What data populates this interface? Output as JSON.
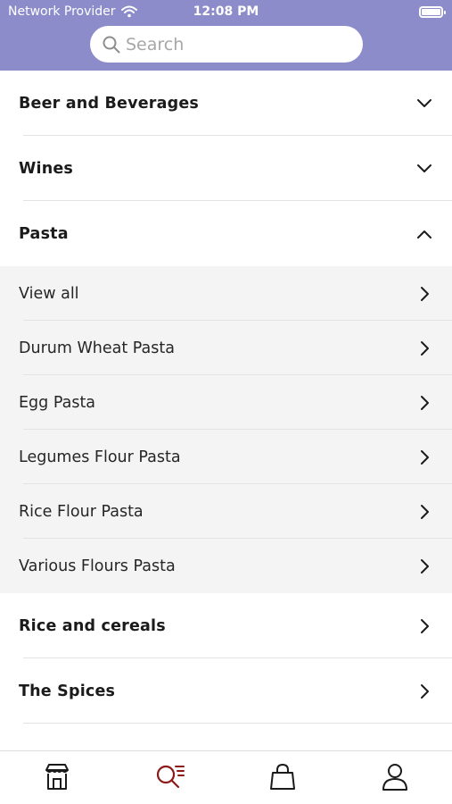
{
  "status_bar": {
    "carrier": "Network Provider",
    "time": "12:08 PM"
  },
  "search": {
    "placeholder": "Search"
  },
  "categories": [
    {
      "label": "Beer and Beverages",
      "state": "collapsed"
    },
    {
      "label": "Wines",
      "state": "collapsed"
    },
    {
      "label": "Pasta",
      "state": "expanded"
    }
  ],
  "pasta_subcategories": [
    {
      "label": "View all"
    },
    {
      "label": "Durum Wheat Pasta"
    },
    {
      "label": "Egg Pasta"
    },
    {
      "label": "Legumes Flour Pasta"
    },
    {
      "label": "Rice Flour Pasta"
    },
    {
      "label": "Various Flours Pasta"
    }
  ],
  "other_categories": [
    {
      "label": "Rice and cereals"
    },
    {
      "label": "The Spices"
    }
  ],
  "tab_bar": {
    "items": [
      {
        "icon": "store-icon",
        "active": false
      },
      {
        "icon": "search-list-icon",
        "active": true
      },
      {
        "icon": "shopping-bag-icon",
        "active": false
      },
      {
        "icon": "user-icon",
        "active": false
      }
    ]
  },
  "colors": {
    "header": "#8c8ccb",
    "accent": "#8b1a1a",
    "sub_background": "#f4f4f4",
    "text": "#1b1b1b"
  }
}
